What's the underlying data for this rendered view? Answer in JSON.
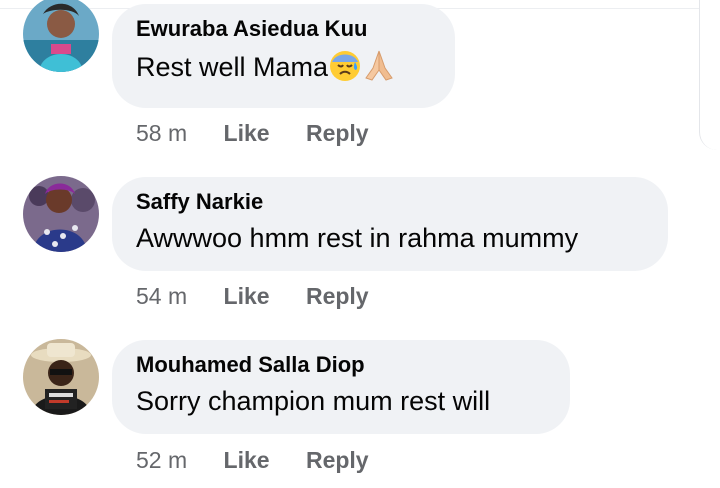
{
  "comments": [
    {
      "author": "Ewuraba Asiedua Kuu",
      "text": "Rest well Mama",
      "emoji": [
        "sad-sweat-face",
        "folded-hands"
      ],
      "time": "58 m",
      "like_label": "Like",
      "reply_label": "Reply"
    },
    {
      "author": "Saffy Narkie",
      "text": "Awwwoo hmm rest in rahma mummy",
      "time": "54 m",
      "like_label": "Like",
      "reply_label": "Reply"
    },
    {
      "author": "Mouhamed Salla Diop",
      "text": "Sorry champion mum rest will",
      "time": "52 m",
      "like_label": "Like",
      "reply_label": "Reply"
    }
  ],
  "colors": {
    "bubble": "#f0f2f5",
    "author_text": "#050505",
    "meta_text": "#65676b"
  }
}
